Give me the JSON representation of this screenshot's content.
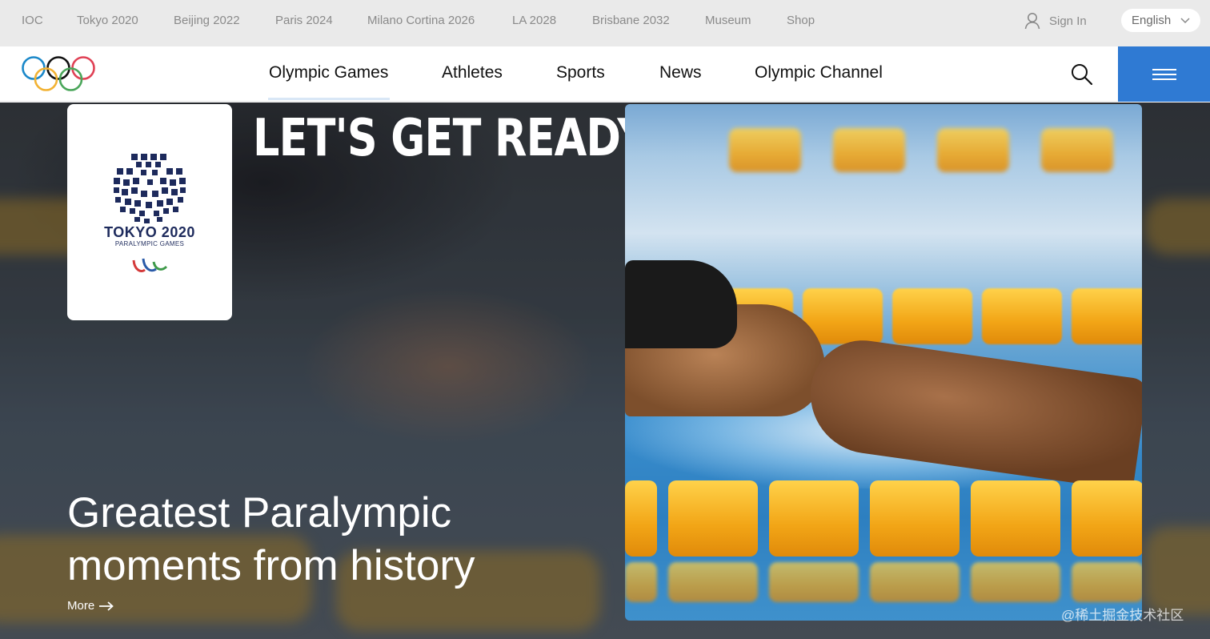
{
  "topbar": {
    "links": [
      "IOC",
      "Tokyo 2020",
      "Beijing 2022",
      "Paris 2024",
      "Milano Cortina 2026",
      "LA 2028",
      "Brisbane 2032",
      "Museum",
      "Shop"
    ],
    "sign_in": "Sign In",
    "language": "English"
  },
  "mainnav": {
    "items": [
      "Olympic Games",
      "Athletes",
      "Sports",
      "News",
      "Olympic Channel"
    ],
    "active": "Olympic Games",
    "logo_icon": "olympic-rings",
    "search_icon": "magnifier",
    "menu_icon": "hamburger",
    "menu_color": "#2f7ad3"
  },
  "hero": {
    "emblem": {
      "year": "TOKYO 2020",
      "subtitle": "PARALYMPIC GAMES"
    },
    "headline": "LET'S GET READY!",
    "title": "Greatest Paralympic moments from history",
    "more": "More",
    "watermark": "@稀土掘金技术社区"
  }
}
